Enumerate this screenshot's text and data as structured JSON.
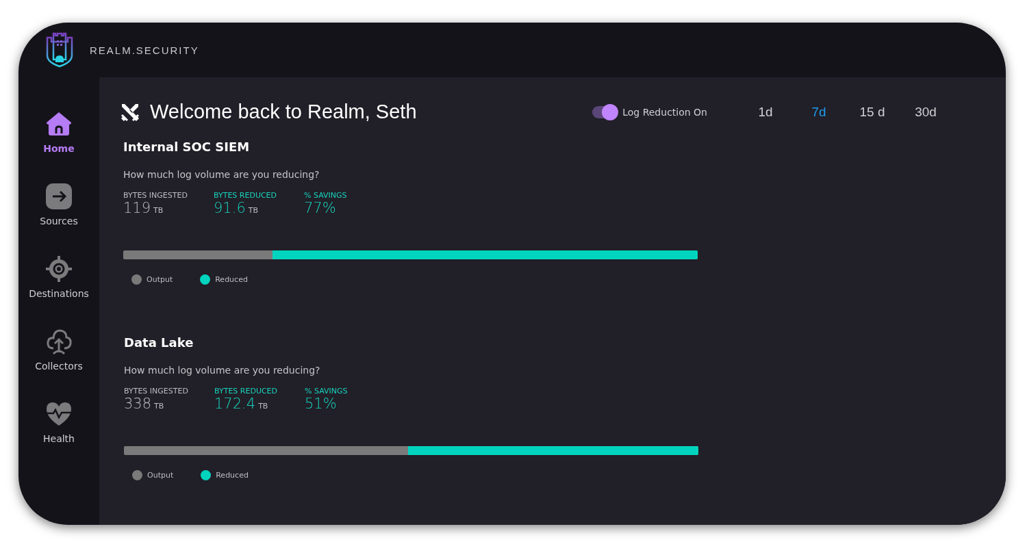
{
  "brand": {
    "name": "REALM.SECURITY"
  },
  "sidebar": {
    "items": [
      {
        "label": "Home",
        "kind": "home",
        "selected": true
      },
      {
        "label": "Sources",
        "kind": "sources",
        "selected": false
      },
      {
        "label": "Destinations",
        "kind": "destinations",
        "selected": false
      },
      {
        "label": "Collectors",
        "kind": "collectors",
        "selected": false
      },
      {
        "label": "Health",
        "kind": "health",
        "selected": false
      }
    ]
  },
  "header": {
    "title": "Welcome back to Realm, Seth",
    "toggle": {
      "label": "Log Reduction On",
      "on": true
    },
    "ranges": [
      {
        "label": "1d",
        "selected": false
      },
      {
        "label": "7d",
        "selected": true
      },
      {
        "label": "15 d",
        "selected": false
      },
      {
        "label": "30d",
        "selected": false
      }
    ]
  },
  "sections": [
    {
      "title": "Internal SOC SIEM",
      "question": "How much log volume are you reducing?",
      "stats": [
        {
          "label": "BYTES INGESTED",
          "value": "119",
          "unit": "TB",
          "kind": "plain"
        },
        {
          "label": "BYTES REDUCED",
          "value": "91.6",
          "unit": "TB",
          "kind": "accent"
        },
        {
          "label": "% SAVINGS",
          "value": "77%",
          "kind": "accent"
        }
      ],
      "bar": {
        "level": 0.74
      },
      "legend": [
        {
          "label": "Output",
          "color": "#7a7a7a"
        },
        {
          "label": "Reduced",
          "color": "#00d4be"
        }
      ]
    },
    {
      "title": "Data Lake",
      "question": "How much log volume are you reducing?",
      "stats": [
        {
          "label": "BYTES INGESTED",
          "value": "338",
          "unit": "TB",
          "kind": "plain"
        },
        {
          "label": "BYTES REDUCED",
          "value": "172.4",
          "unit": "TB",
          "kind": "accent"
        },
        {
          "label": "% SAVINGS",
          "value": "51%",
          "kind": "accent"
        }
      ],
      "bar": {
        "level": 0.505
      },
      "legend": [
        {
          "label": "Output",
          "color": "#7a7a7a"
        },
        {
          "label": "Reduced",
          "color": "#00d4be"
        }
      ]
    }
  ]
}
